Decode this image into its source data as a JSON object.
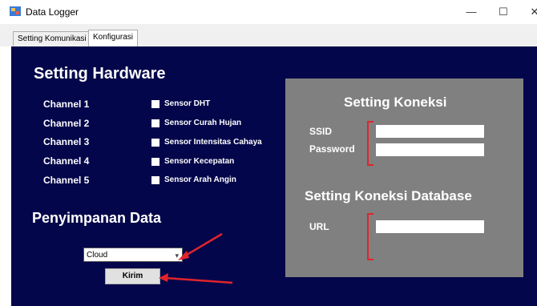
{
  "window": {
    "title": "Data Logger",
    "minimize": "—",
    "maximize": "☐",
    "close": "✕"
  },
  "tabs": [
    {
      "label": "Setting Komunikasi"
    },
    {
      "label": "Konfigurasi"
    }
  ],
  "hardware": {
    "title": "Setting Hardware",
    "channels": [
      {
        "channel": "Channel 1",
        "sensor": "Sensor DHT"
      },
      {
        "channel": "Channel 2",
        "sensor": "Sensor Curah Hujan"
      },
      {
        "channel": "Channel 3",
        "sensor": "Sensor Intensitas Cahaya"
      },
      {
        "channel": "Channel 4",
        "sensor": "Sensor Kecepatan"
      },
      {
        "channel": "Channel 5",
        "sensor": "Sensor Arah Angin"
      }
    ]
  },
  "storage": {
    "title": "Penyimpanan Data",
    "selected": "Cloud",
    "submit": "Kirim"
  },
  "connection": {
    "title": "Setting Koneksi",
    "ssid_label": "SSID",
    "password_label": "Password",
    "ssid_value": "",
    "password_value": ""
  },
  "database": {
    "title": "Setting Koneksi Database",
    "url_label": "URL",
    "url_value": ""
  },
  "colors": {
    "panel": "#03064a",
    "group": "#808080",
    "annotation": "#e0242c"
  }
}
